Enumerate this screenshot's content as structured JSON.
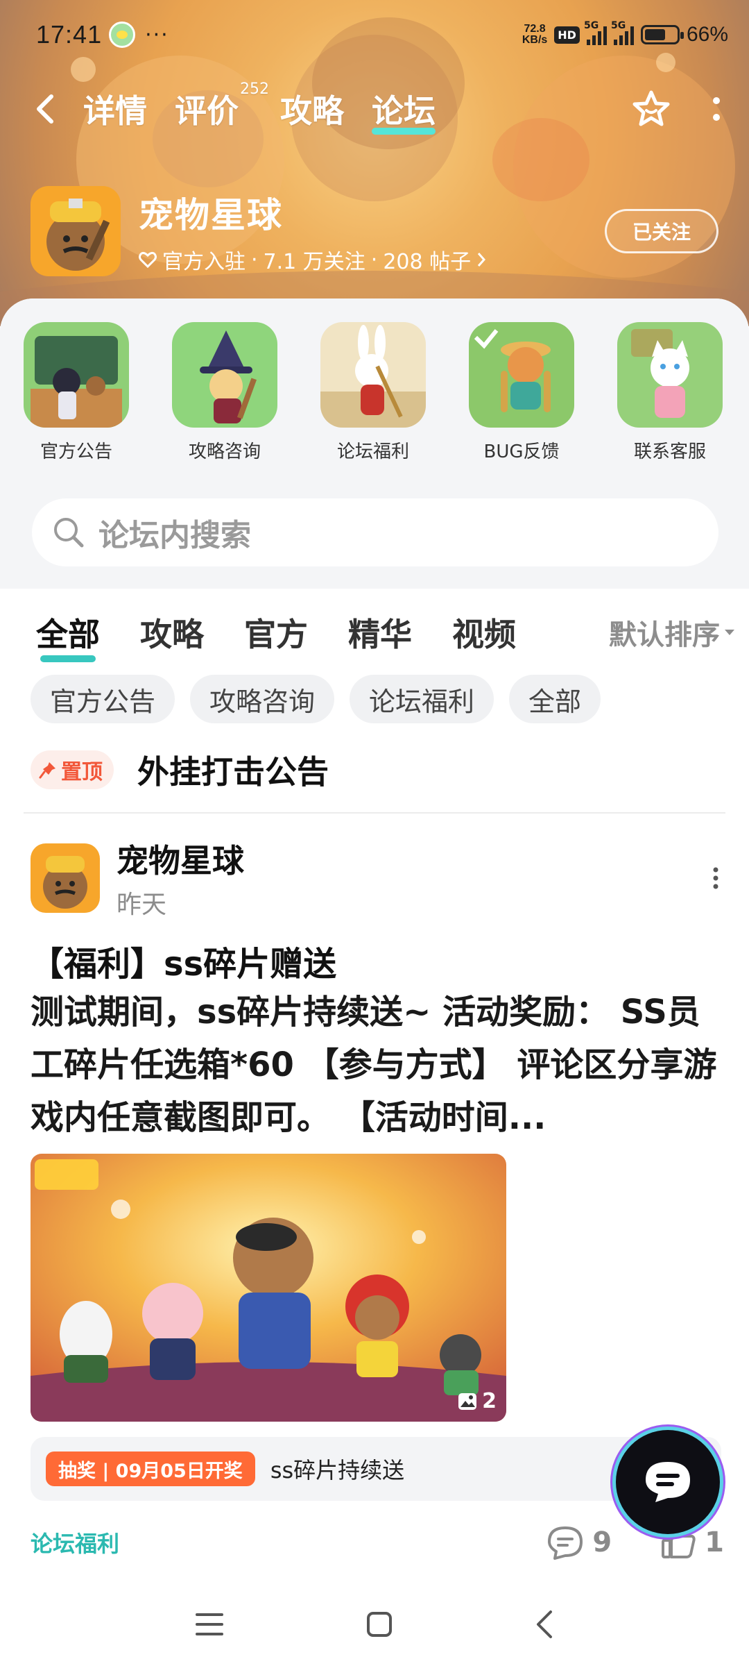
{
  "status_bar": {
    "time": "17:41",
    "dots": "···",
    "speed_value": "72.8",
    "speed_unit": "KB/s",
    "hd_label": "HD",
    "net1": "5G",
    "net2": "5G",
    "battery_percent": "66%",
    "battery_level": 0.66
  },
  "top_nav": {
    "tabs": [
      {
        "label": "详情"
      },
      {
        "label": "评价",
        "count": "252"
      },
      {
        "label": "攻略"
      },
      {
        "label": "论坛"
      }
    ],
    "active_tab": "论坛",
    "back_icon": "chevron-left-icon",
    "star_icon": "star-outline-icon",
    "more_icon": "more-vertical-icon"
  },
  "game": {
    "title": "宠物星球",
    "official": "官方入驻",
    "sep1": "·",
    "followers": "7.1 万关注",
    "sep2": "·",
    "posts": "208 帖子",
    "follow_button": "已关注"
  },
  "shortcuts": [
    {
      "label": "官方公告"
    },
    {
      "label": "攻略咨询"
    },
    {
      "label": "论坛福利"
    },
    {
      "label": "BUG反馈"
    },
    {
      "label": "联系客服"
    }
  ],
  "search": {
    "placeholder": "论坛内搜索"
  },
  "filter_tabs": [
    {
      "label": "全部"
    },
    {
      "label": "攻略"
    },
    {
      "label": "官方"
    },
    {
      "label": "精华"
    },
    {
      "label": "视频"
    }
  ],
  "sort_label": "默认排序",
  "chips": [
    {
      "label": "官方公告"
    },
    {
      "label": "攻略咨询"
    },
    {
      "label": "论坛福利"
    },
    {
      "label": "全部"
    }
  ],
  "pinned": {
    "badge": "置顶",
    "title": "外挂打击公告"
  },
  "post": {
    "author": "宠物星球",
    "time": "昨天",
    "title": "【福利】ss碎片赠送",
    "body": "测试期间，ss碎片持续送~ 活动奖励： SS员工碎片任选箱*60 【参与方式】 评论区分享游戏内任意截图即可。 【活动时间...",
    "image_count": "2",
    "lottery_tag": "抽奖 | 09月05日开奖",
    "lottery_text": "ss碎片持续送",
    "tag": "论坛福利",
    "comments": "9",
    "likes": "1"
  },
  "colors": {
    "accent": "#38c7bf",
    "accent_text": "#2bb9b0",
    "pin": "#f2583a",
    "lottery": "#ff6a36"
  }
}
